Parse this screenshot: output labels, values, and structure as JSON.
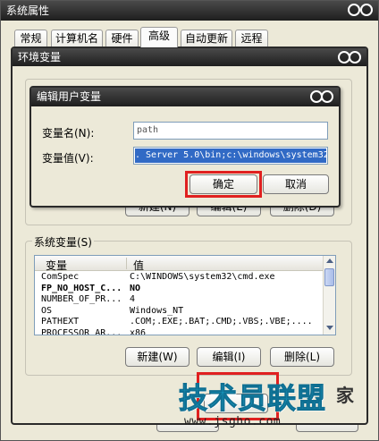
{
  "system_props": {
    "title": "系统属性",
    "tabs": [
      "常规",
      "计算机名",
      "硬件",
      "高级",
      "自动更新",
      "远程"
    ],
    "active_tab": "高级"
  },
  "env_vars": {
    "title": "环境变量",
    "user_buttons": {
      "new": "新建(N)",
      "edit": "编辑(E)",
      "delete": "删除(D)"
    },
    "system_group_label": "系统变量(S)",
    "columns": {
      "variable": "变量",
      "value": "值"
    },
    "system_rows": [
      {
        "name": "ComSpec",
        "value": "C:\\WINDOWS\\system32\\cmd.exe"
      },
      {
        "name": "FP_NO_HOST_C...",
        "value": "NO"
      },
      {
        "name": "NUMBER_OF_PR...",
        "value": "4"
      },
      {
        "name": "OS",
        "value": "Windows_NT"
      },
      {
        "name": "PATHEXT",
        "value": ".COM;.EXE;.BAT;.CMD;.VBS;.VBE;...."
      },
      {
        "name": "PROCESSOR_AR...",
        "value": "x86"
      }
    ],
    "system_buttons": {
      "new": "新建(W)",
      "edit": "编辑(I)",
      "delete": "删除(L)"
    }
  },
  "edit_dialog": {
    "title": "编辑用户变量",
    "name_label": "变量名(N):",
    "name_value": "path",
    "value_label": "变量值(V):",
    "value_value": ". Server 5.0\\bin;c:\\windows\\system32",
    "ok": "确定",
    "cancel": "取消"
  },
  "watermark": {
    "brand_large": "技术员联盟",
    "brand_small": "家",
    "url": "www.jsgho.com"
  },
  "colors": {
    "highlight_box": "#e02020",
    "titlebar": "#2a2a2a",
    "dialog_face": "#ece9d8"
  }
}
